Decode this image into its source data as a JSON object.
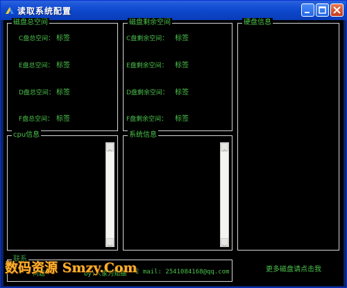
{
  "window": {
    "title": "读取系统配置",
    "controls": {
      "minimize": "minimize-icon",
      "maximize": "maximize-icon",
      "close": "close-icon"
    }
  },
  "disk_total": {
    "title": "磁盘总空间",
    "rows": [
      {
        "label": "C盘总空间：",
        "value": "标签"
      },
      {
        "label": "E盘总空间：",
        "value": "标签"
      },
      {
        "label": "D盘总空间：",
        "value": "标签"
      },
      {
        "label": "F盘总空间：",
        "value": "标签"
      }
    ]
  },
  "disk_free": {
    "title": "磁盘剩余空间",
    "rows": [
      {
        "label": "C盘剩余空间：",
        "value": "标签"
      },
      {
        "label": "E盘剩余空间：",
        "value": "标签"
      },
      {
        "label": "D盘剩余空间：",
        "value": "标签"
      },
      {
        "label": "F盘剩余空间：",
        "value": "标签"
      }
    ]
  },
  "hdd_info": {
    "title": "硬盘信息"
  },
  "cpu_info": {
    "title": "cpu信息"
  },
  "system_info": {
    "title": "系统信息"
  },
  "bottom": {
    "group_title": "联系",
    "text1": "问题",
    "text2": "by:人家为知细",
    "text3": "E mail: 2541084168@qq.com",
    "watermark": "数码资源 Smzy.Com",
    "more_link": "更多磁盘请点击我"
  },
  "colors": {
    "text_green": "#4cc24c",
    "background": "#000000",
    "watermark": "#ffb02e"
  }
}
